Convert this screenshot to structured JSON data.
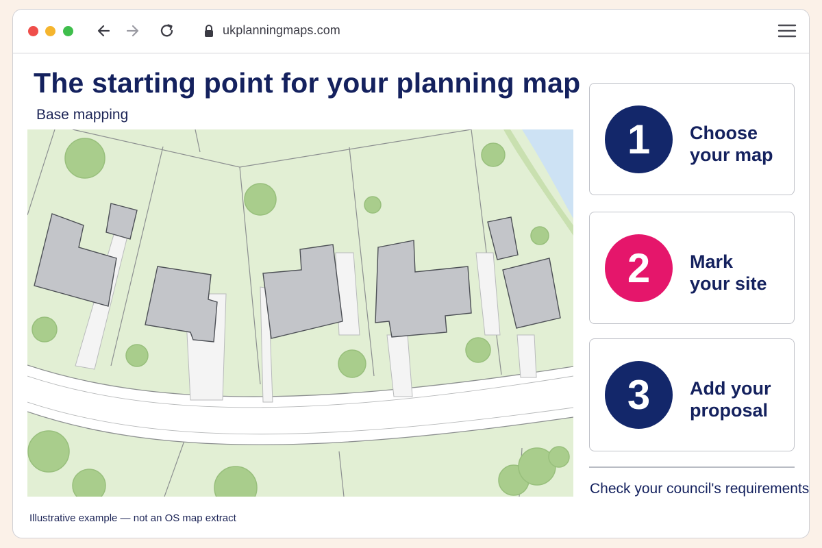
{
  "browser": {
    "url": "ukplanningmaps.com",
    "icons": [
      "close-dot",
      "minimize-dot",
      "zoom-dot",
      "back-arrow-icon",
      "forward-arrow-icon",
      "reload-icon",
      "lock-icon",
      "hamburger-menu-icon"
    ]
  },
  "page": {
    "title": "The starting point for your planning map",
    "subtitle": "Base mapping",
    "caption": "Illustrative example — not an OS map extract"
  },
  "steps": [
    {
      "number": "1",
      "line1": "Choose",
      "line2": "your map",
      "color": "#13276a"
    },
    {
      "number": "2",
      "line1": "Mark",
      "line2": "your site",
      "color": "#e5166b"
    },
    {
      "number": "3",
      "line1": "Add your",
      "line2": "proposal",
      "color": "#13276a"
    }
  ],
  "footer": {
    "requirements": "Check your council's requirements"
  },
  "colors": {
    "heading": "#14215e",
    "map_grass": "#e2efd4",
    "map_building": "#c3c5c9",
    "map_tree": "#a9cd8c",
    "map_water": "#cde2f4",
    "map_road": "#ffffff"
  }
}
